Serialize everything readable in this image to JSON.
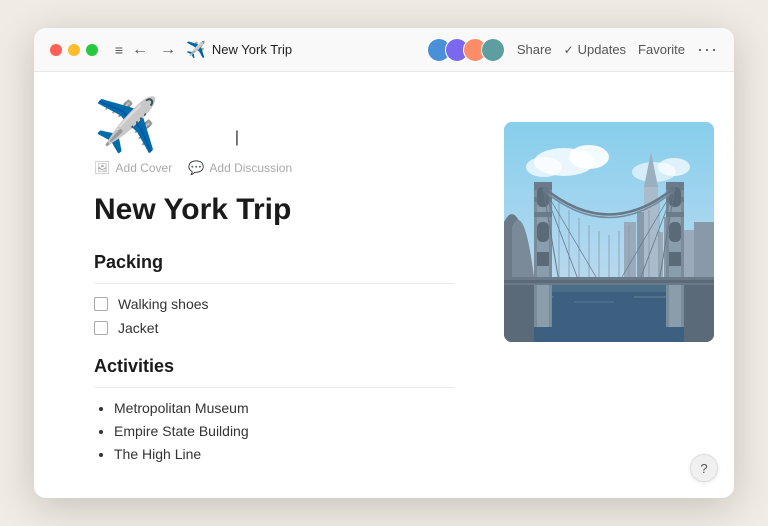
{
  "titlebar": {
    "title": "New York Trip",
    "plane_emoji": "✈️",
    "share_label": "Share",
    "updates_label": "Updates",
    "favorite_label": "Favorite",
    "more_dots": "•••",
    "nav_back": "←",
    "nav_forward": "→",
    "hamburger": "≡"
  },
  "page": {
    "icon": "✈️",
    "title": "New York Trip",
    "add_cover_label": "Add Cover",
    "add_discussion_label": "Add Discussion"
  },
  "packing": {
    "section_title": "Packing",
    "items": [
      {
        "label": "Walking shoes",
        "checked": false
      },
      {
        "label": "Jacket",
        "checked": false
      }
    ]
  },
  "activities": {
    "section_title": "Activities",
    "items": [
      {
        "label": "Metropolitan Museum"
      },
      {
        "label": "Empire State Building"
      },
      {
        "label": "The High Line"
      }
    ]
  },
  "help": {
    "label": "?"
  },
  "avatars": [
    {
      "id": 1,
      "color": "#4a90d9"
    },
    {
      "id": 2,
      "color": "#7b68ee"
    },
    {
      "id": 3,
      "color": "#ff8c69"
    },
    {
      "id": 4,
      "color": "#5f9ea0"
    }
  ]
}
